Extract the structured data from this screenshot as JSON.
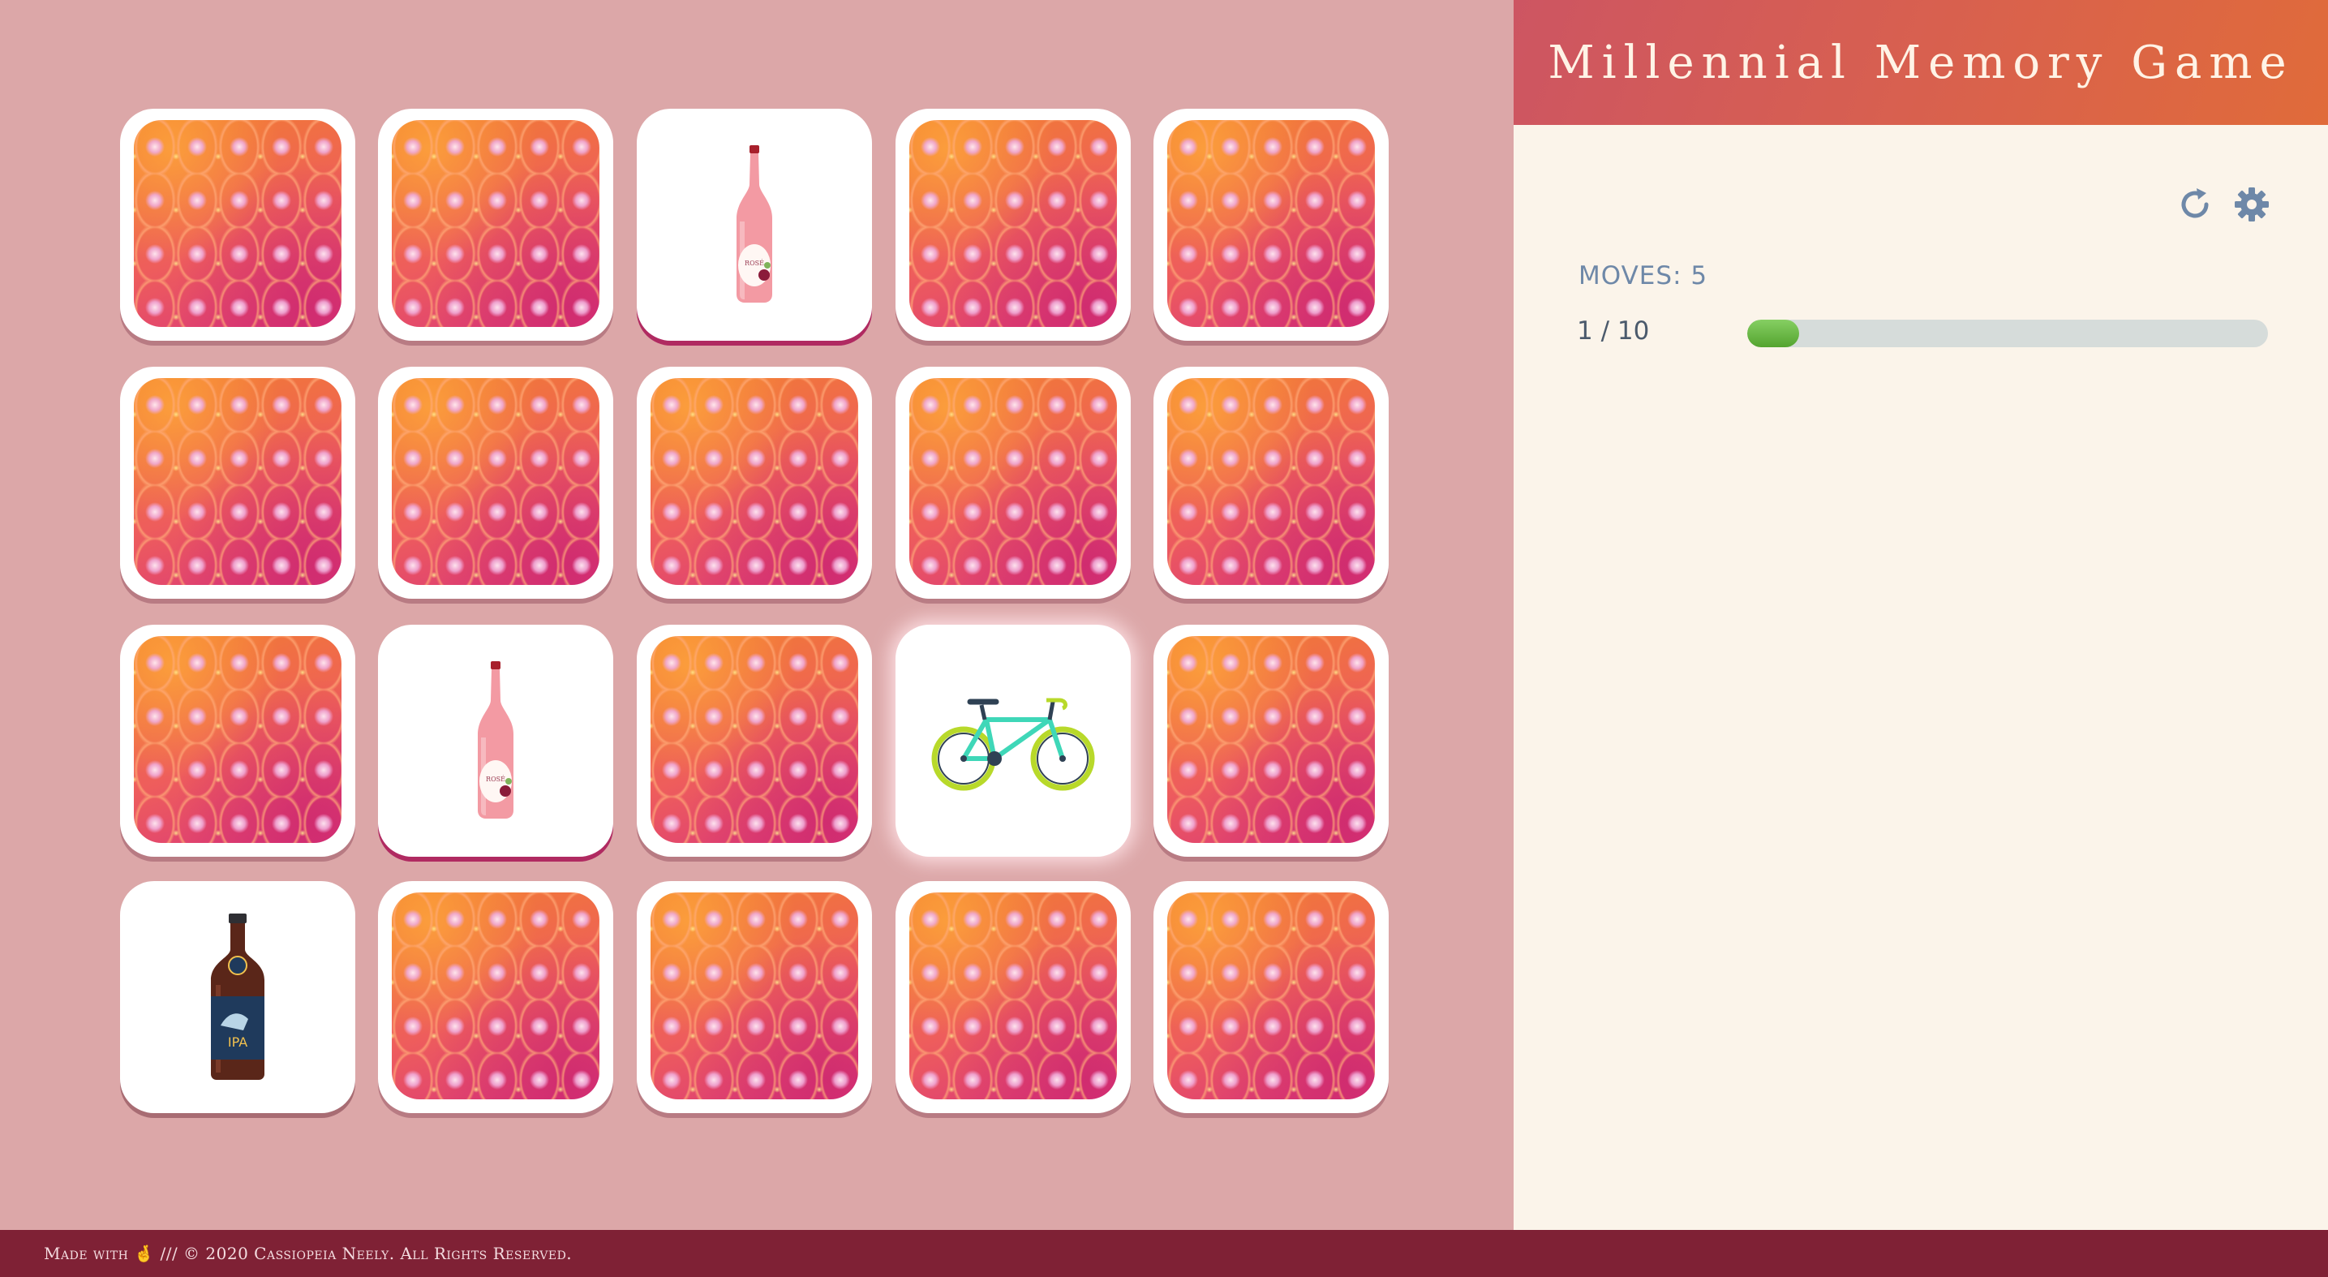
{
  "app": {
    "title": "Millennial Memory Game"
  },
  "controls": {
    "restart_icon": "restart-icon",
    "settings_icon": "gear-icon"
  },
  "stats": {
    "moves_text": "MOVES: 5",
    "pairs_text": "1 / 10",
    "progress_fraction": 0.1
  },
  "board": {
    "rows": 4,
    "columns": 5,
    "cards": [
      {
        "state": "hidden"
      },
      {
        "state": "hidden"
      },
      {
        "state": "revealed",
        "icon": "rose-wine-bottle-icon"
      },
      {
        "state": "hidden"
      },
      {
        "state": "hidden"
      },
      {
        "state": "hidden"
      },
      {
        "state": "hidden"
      },
      {
        "state": "hidden"
      },
      {
        "state": "hidden"
      },
      {
        "state": "hidden"
      },
      {
        "state": "hidden"
      },
      {
        "state": "revealed",
        "icon": "rose-wine-bottle-icon"
      },
      {
        "state": "hidden"
      },
      {
        "state": "revealed-active",
        "icon": "bicycle-icon"
      },
      {
        "state": "hidden"
      },
      {
        "state": "revealed",
        "icon": "ipa-beer-bottle-icon"
      },
      {
        "state": "hidden"
      },
      {
        "state": "hidden"
      },
      {
        "state": "hidden"
      },
      {
        "state": "hidden"
      }
    ]
  },
  "footer": {
    "text": "Made with 🤞 /// © 2020 Cassiopeia Neely. All Rights Reserved."
  },
  "colors": {
    "board_bg": "#dca7a8",
    "panel_bg": "#fbf4ea",
    "banner_start": "#cd5562",
    "banner_end": "#e06b3a",
    "footer_bg": "#7f2135",
    "progress_fill": "#67b844",
    "progress_track": "#d6dcda",
    "moves_text": "#6e88a8"
  }
}
